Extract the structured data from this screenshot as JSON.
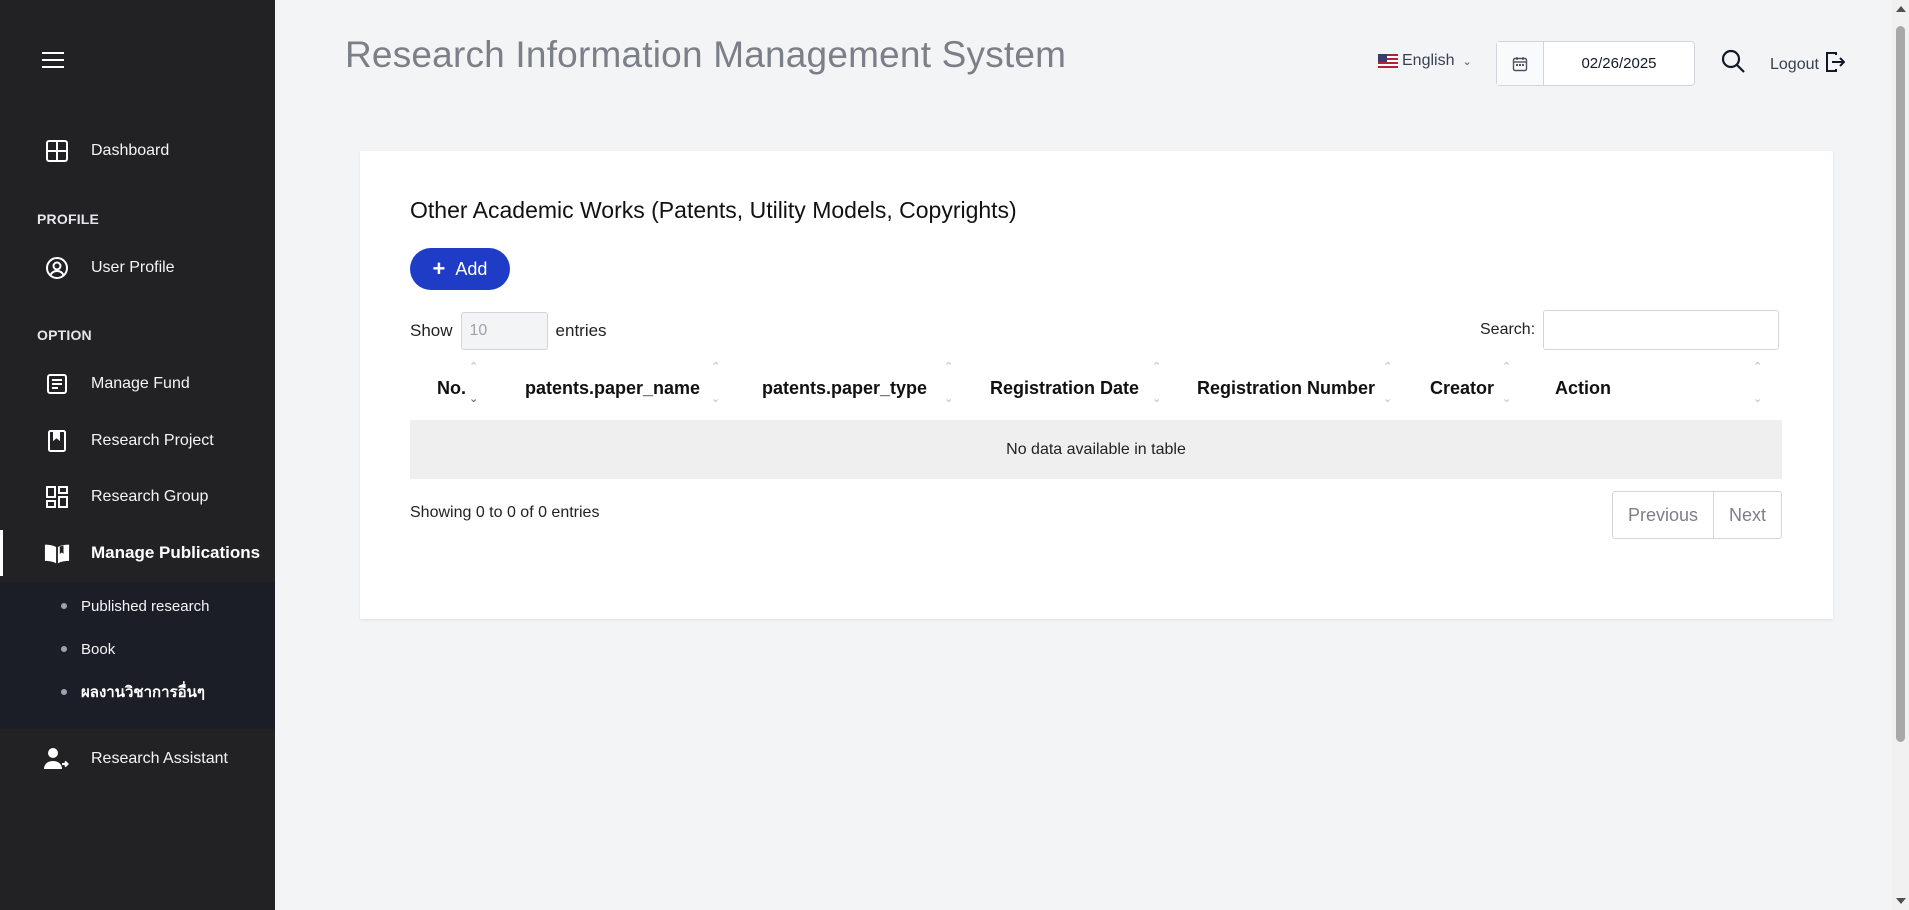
{
  "sidebar": {
    "menu_icon": "hamburger-icon",
    "dashboard": {
      "label": "Dashboard",
      "icon": "grid-icon"
    },
    "section_profile": "PROFILE",
    "user_profile": {
      "label": "User Profile",
      "icon": "user-circle-icon"
    },
    "section_option": "OPTION",
    "manage_fund": {
      "label": "Manage Fund",
      "icon": "document-icon"
    },
    "research_project": {
      "label": "Research Project",
      "icon": "bookmark-icon"
    },
    "research_group": {
      "label": "Research Group",
      "icon": "dashboard-tiles-icon"
    },
    "manage_publications": {
      "label": "Manage Publications",
      "icon": "open-book-icon"
    },
    "submenu": [
      {
        "label": "Published research"
      },
      {
        "label": "Book"
      },
      {
        "label": "ผลงานวิชาการอื่นๆ"
      }
    ],
    "research_assistant": {
      "label": "Research Assistant",
      "icon": "user-plus-icon"
    }
  },
  "header": {
    "title": "Research Information Management System",
    "language": "English",
    "date": "02/26/2025",
    "logout": "Logout"
  },
  "main": {
    "card_title": "Other Academic Works (Patents, Utility Models, Copyrights)",
    "add_label": "Add",
    "show_label": "Show",
    "entries_label": "entries",
    "page_length": "10",
    "search_label": "Search:",
    "search_value": "",
    "columns": [
      "No.",
      "patents.paper_name",
      "patents.paper_type",
      "Registration Date",
      "Registration Number",
      "Creator",
      "Action"
    ],
    "empty_text": "No data available in table",
    "info": "Showing 0 to 0 of 0 entries",
    "prev_label": "Previous",
    "next_label": "Next"
  },
  "colors": {
    "sidebar_bg": "#222225",
    "submenu_bg": "#1b1e27",
    "accent": "#1f3cc7",
    "page_bg": "#f3f4f6"
  }
}
